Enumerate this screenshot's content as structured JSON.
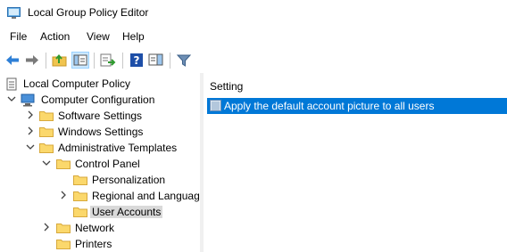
{
  "window": {
    "title": "Local Group Policy Editor"
  },
  "menu": {
    "file": "File",
    "action": "Action",
    "view": "View",
    "help": "Help"
  },
  "tree": {
    "root": "Local Computer Policy",
    "computer_configuration": "Computer Configuration",
    "software_settings": "Software Settings",
    "windows_settings": "Windows Settings",
    "administrative_templates": "Administrative Templates",
    "control_panel": "Control Panel",
    "personalization": "Personalization",
    "regional": "Regional and Languag",
    "user_accounts": "User Accounts",
    "network": "Network",
    "printers": "Printers"
  },
  "list": {
    "column_setting": "Setting",
    "rows": [
      "Apply the default account picture to all users"
    ]
  },
  "colors": {
    "selection": "#0078d7",
    "tree_selected": "#d9d9d9",
    "folder": "#f0c44e"
  }
}
